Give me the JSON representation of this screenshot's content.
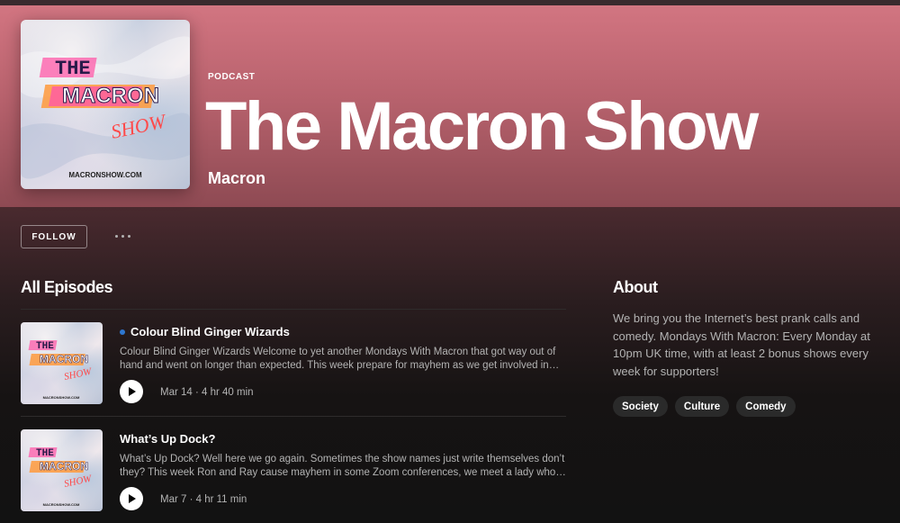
{
  "podcast": {
    "type_label": "PODCAST",
    "title": "The Macron Show",
    "author": "Macron",
    "cover_text": {
      "line1": "THE",
      "line2": "MACRON",
      "line3": "SHOW",
      "url": "MACRONSHOW.COM"
    }
  },
  "actions": {
    "follow_label": "FOLLOW",
    "more_icon": "more-horizontal-icon"
  },
  "episodes_section": {
    "heading": "All Episodes",
    "episodes": [
      {
        "title": "Colour Blind Ginger Wizards",
        "is_new": true,
        "description": "Colour Blind Ginger Wizards Welcome to yet another Mondays With Macron that got way out of hand and went on longer than expected. This week prepare for mayhem as we get involved in…",
        "meta": "Mar 14 · 4 hr 40 min"
      },
      {
        "title": "What’s Up Dock?",
        "is_new": false,
        "description": "What’s Up Dock? Well here we go again. Sometimes the show names just write themselves don’t they? This week Ron and Ray cause mayhem in some Zoom conferences, we meet a lady who f…",
        "meta": "Mar 7 · 4 hr 11 min"
      }
    ]
  },
  "about": {
    "heading": "About",
    "text": "We bring you the Internet’s best prank calls and comedy. Mondays With Macron: Every Monday at 10pm UK time, with at least 2 bonus shows every week for supporters!",
    "tags": [
      "Society",
      "Culture",
      "Comedy"
    ]
  },
  "colors": {
    "hero_top": "#d27581",
    "hero_bottom": "#8e4a53",
    "background": "#121212",
    "new_dot": "#2e77d0"
  }
}
